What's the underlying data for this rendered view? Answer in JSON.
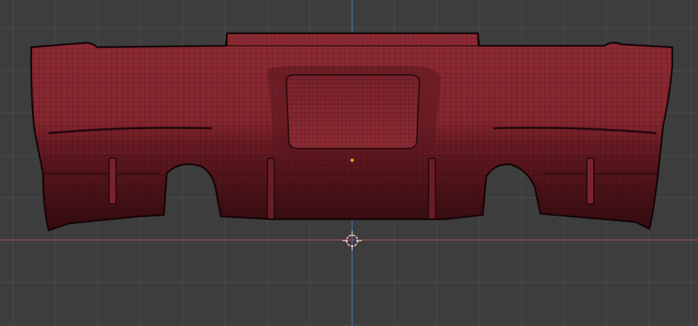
{
  "viewport": {
    "background_color": "#3d3d3d",
    "grid_color": "#4a4a4a",
    "x_axis_color": "#c0545c",
    "y_axis_color": "#4d7fd1",
    "mesh_color": "#8a2a33",
    "mesh_dark_color": "#4a1016",
    "wire_color": "#1a0a0c",
    "origin_dot_color": "#f39c12",
    "cursor_color": "#ffffff"
  },
  "icons": {
    "cursor": "3d-cursor-icon",
    "origin": "object-origin-icon"
  }
}
